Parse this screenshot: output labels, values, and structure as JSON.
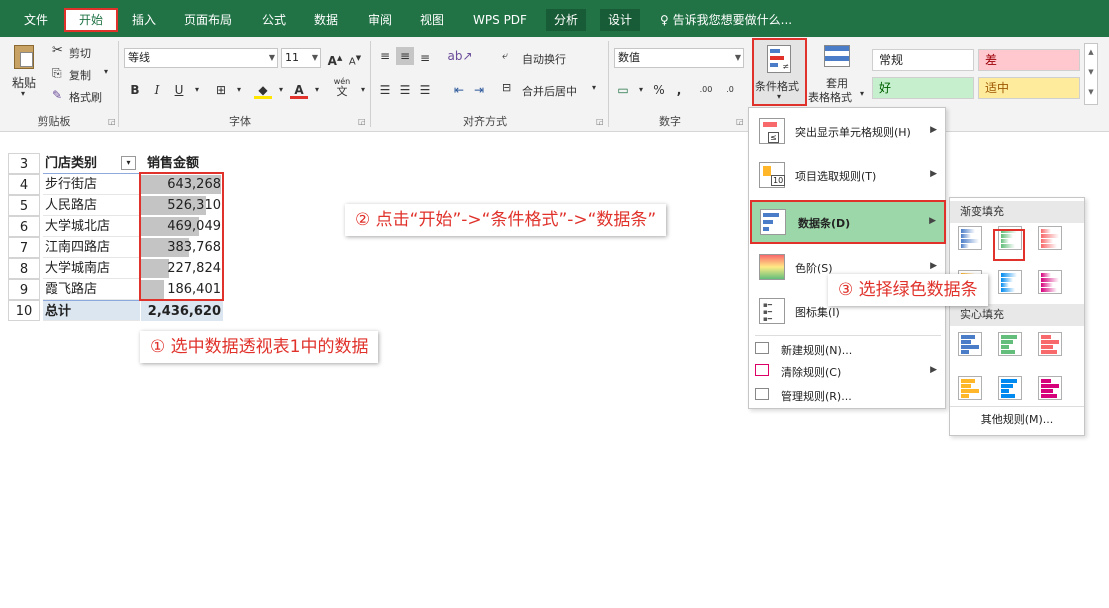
{
  "tabs": [
    "文件",
    "开始",
    "插入",
    "页面布局",
    "公式",
    "数据",
    "审阅",
    "视图",
    "WPS PDF",
    "分析",
    "设计"
  ],
  "tell_me": "告诉我您想要做什么...",
  "ribbon": {
    "clipboard": {
      "paste": "粘贴",
      "cut": "剪切",
      "copy": "复制",
      "format_painter": "格式刷",
      "group": "剪贴板"
    },
    "font": {
      "name": "等线",
      "size": "11",
      "bold": "B",
      "italic": "I",
      "underline": "U",
      "grow": "A",
      "shrink": "A",
      "font_color": "A",
      "wen": "wén",
      "wen2": "文",
      "group": "字体"
    },
    "align": {
      "wrap": "自动换行",
      "merge": "合并后居中",
      "group": "对齐方式"
    },
    "number": {
      "format": "数值",
      "percent": "%",
      "comma": ",",
      "inc_dec": ".00",
      "dec_dec": ".0",
      "group": "数字"
    },
    "styles": {
      "cond_format": "条件格式",
      "table_format_1": "套用",
      "table_format_2": "表格格式",
      "normal": "常规",
      "bad": "差",
      "good": "好",
      "neutral": "适中"
    }
  },
  "table": {
    "header": {
      "row": "3",
      "col1": "门店类别",
      "col2": "销售金额"
    },
    "rows": [
      {
        "row": "4",
        "name": "步行街店",
        "value": "643,268",
        "amount": 643268
      },
      {
        "row": "5",
        "name": "人民路店",
        "value": "526,310",
        "amount": 526310
      },
      {
        "row": "6",
        "name": "大学城北店",
        "value": "469,049",
        "amount": 469049
      },
      {
        "row": "7",
        "name": "江南四路店",
        "value": "383,768",
        "amount": 383768
      },
      {
        "row": "8",
        "name": "大学城南店",
        "value": "227,824",
        "amount": 227824
      },
      {
        "row": "9",
        "name": "霞飞路店",
        "value": "186,401",
        "amount": 186401
      }
    ],
    "total": {
      "row": "10",
      "name": "总计",
      "value": "2,436,620"
    }
  },
  "callouts": {
    "one": "① 选中数据透视表1中的数据",
    "two": "② 点击“开始”->“条件格式”->“数据条”",
    "three": "③ 选择绿色数据条"
  },
  "menu": {
    "highlight": "突出显示单元格规则(H)",
    "topbottom": "项目选取规则(T)",
    "databar": "数据条(D)",
    "colorscale": "色阶(S)",
    "iconset": "图标集(I)",
    "new_rule": "新建规则(N)...",
    "clear_rule": "清除规则(C)",
    "manage_rule": "管理规则(R)..."
  },
  "submenu": {
    "gradient": "渐变填充",
    "solid": "实心填充",
    "more": "其他规则(M)..."
  },
  "colors": {
    "excel_green": "#217346",
    "accent_red": "#e0322b",
    "gradient_bars": [
      "#4a7cc7",
      "#63be7b",
      "#f8696b",
      "#ffb628",
      "#008aef",
      "#d6007b"
    ]
  }
}
